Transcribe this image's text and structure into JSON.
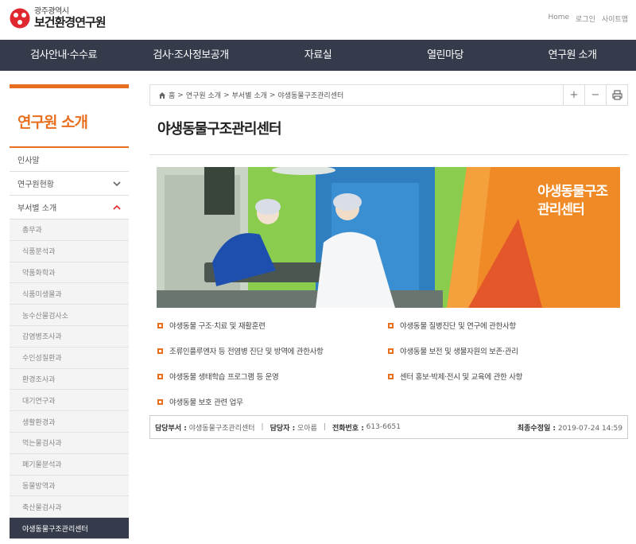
{
  "header": {
    "logo_sub": "광주광역시",
    "logo_main": "보건환경연구원",
    "util_links": [
      "Home",
      "로그인",
      "사이트맵"
    ]
  },
  "gnb": [
    "검사안내·수수료",
    "검사·조사정보공개",
    "자료실",
    "열린마당",
    "연구원 소개"
  ],
  "sidebar": {
    "title": "연구원 소개",
    "items": [
      {
        "label": "인사말"
      },
      {
        "label": "연구원현황",
        "icon": "chevron-down-icon"
      },
      {
        "label": "부서별 소개",
        "icon": "chevron-up-icon"
      }
    ],
    "submenu": [
      "총무과",
      "식품분석과",
      "약품화학과",
      "식품미생물과",
      "농수산물검사소",
      "감염병조사과",
      "수인성질환과",
      "환경조사과",
      "대기연구과",
      "생활환경과",
      "먹는물검사과",
      "폐기물분석과",
      "동물방역과",
      "축산물검사과",
      "야생동물구조관리센터"
    ],
    "active_submenu": "야생동물구조관리센터"
  },
  "breadcrumb": [
    "홈",
    ">",
    "연구원 소개",
    ">",
    "부서별 소개",
    ">",
    "야생동물구조관리센터"
  ],
  "tools": [
    "+",
    "−",
    "print-icon"
  ],
  "page_title": "야생동물구조관리센터",
  "hero_text_line1": "야생동물구조",
  "hero_text_line2": "관리센터",
  "duties": [
    "야생동물 구조·치료 및 재활훈련",
    "야생동물 질병진단 및 연구에 관한사항",
    "조류인플루엔자 등 전염병 진단 및 방역에 관한사항",
    "야생동물 보전 및 생물자원의 보존·관리",
    "야생동물 생태학습 프로그램 등 운영",
    "센터 홍보·박제·전시 및 교육에 관한 사항",
    "야생동물 보호 관련 업무"
  ],
  "info": {
    "dept_label": "담당부서 :",
    "dept_value": "야생동물구조관리센터",
    "person_label": "담당자 :",
    "person_value": "오아름",
    "phone_label": "전화번호 :",
    "phone_value": "613-6651",
    "updated_label": "최종수정일 :",
    "updated_value": "2019-07-24 14:59"
  },
  "colors": {
    "accent": "#e86f1f",
    "nav_bg": "#353b4a",
    "active_bg": "#353b4a"
  }
}
